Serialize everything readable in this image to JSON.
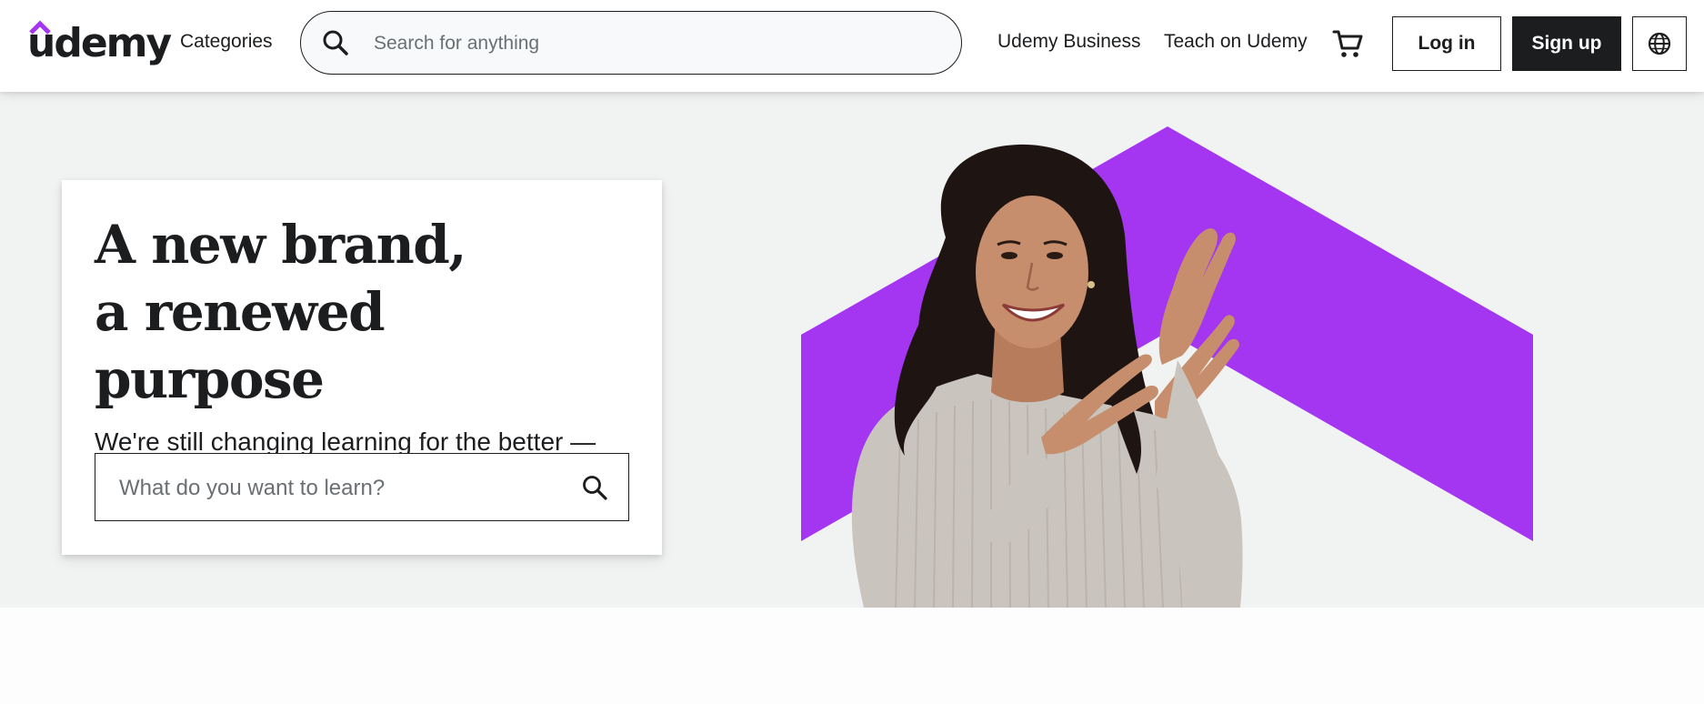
{
  "header": {
    "logo_text": "udemy",
    "categories_label": "Categories",
    "search_placeholder": "Search for anything",
    "business_label": "Udemy Business",
    "teach_label": "Teach on Udemy",
    "login_label": "Log in",
    "signup_label": "Sign up",
    "icons": {
      "search": "search-icon",
      "cart": "cart-icon",
      "language": "globe-icon"
    }
  },
  "hero": {
    "headline_line1": "A new brand,",
    "headline_line2": "a renewed purpose",
    "subhead": "We're still changing learning for the better — now we just look better doing it",
    "search_placeholder": "What do you want to learn?"
  },
  "colors": {
    "brand_purple": "#a435f0",
    "text_dark": "#1c1d1f",
    "hero_background": "#f1f2f2",
    "search_background": "#f7f9fa"
  }
}
